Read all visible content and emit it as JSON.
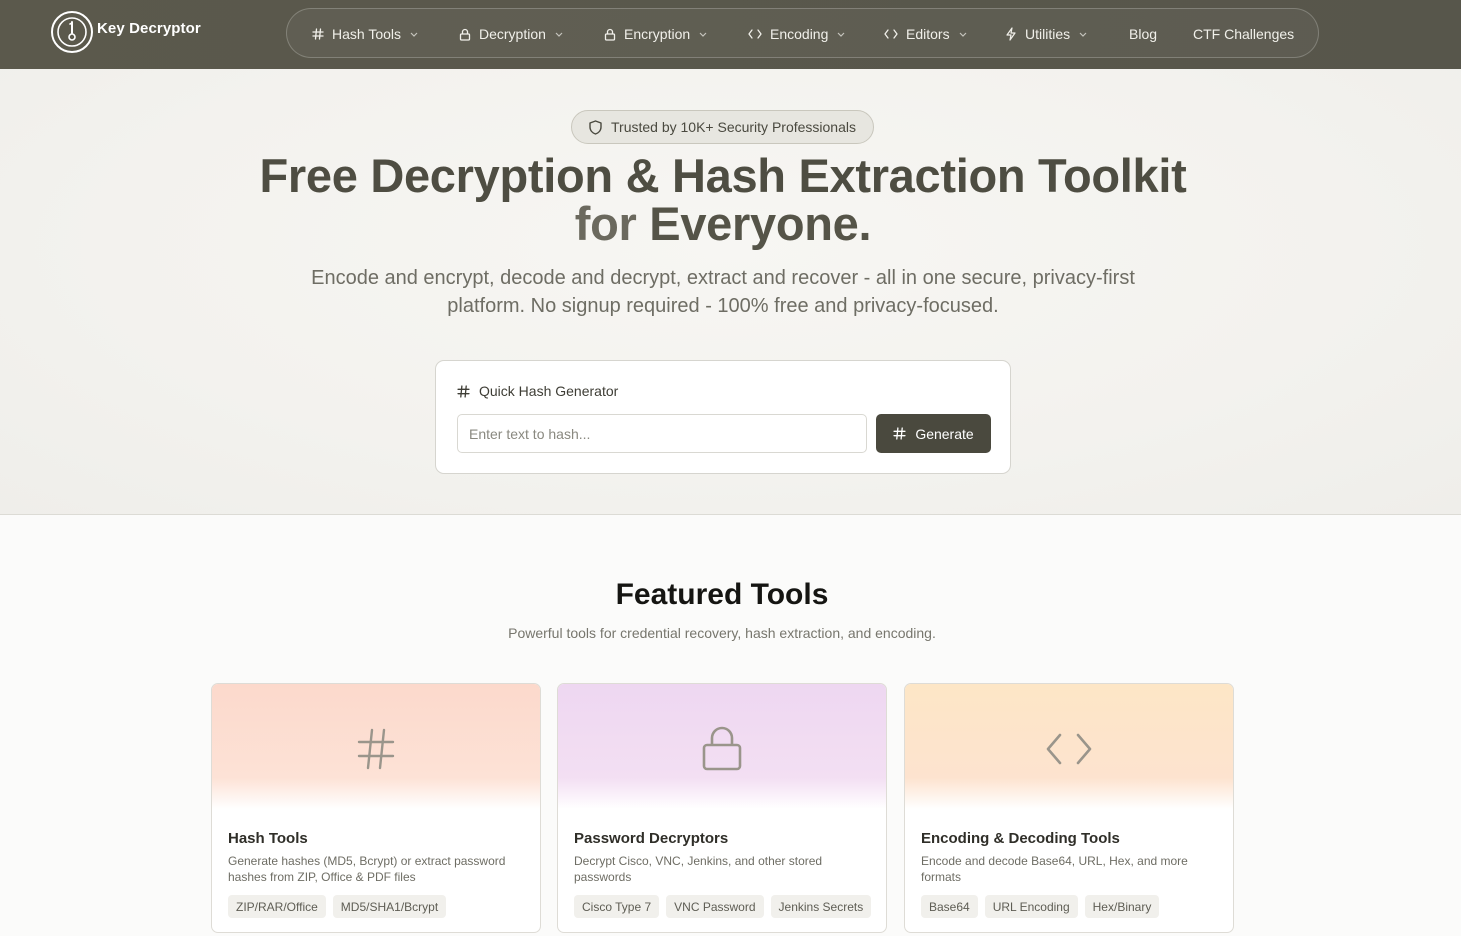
{
  "brand": {
    "name": "Key Decryptor"
  },
  "nav": {
    "items": [
      {
        "label": "Hash Tools",
        "icon": "hash-icon",
        "dropdown": true
      },
      {
        "label": "Decryption",
        "icon": "lock-icon",
        "dropdown": true
      },
      {
        "label": "Encryption",
        "icon": "lock-icon",
        "dropdown": true
      },
      {
        "label": "Encoding",
        "icon": "code-icon",
        "dropdown": true
      },
      {
        "label": "Editors",
        "icon": "code-icon",
        "dropdown": true
      },
      {
        "label": "Utilities",
        "icon": "bolt-icon",
        "dropdown": true
      },
      {
        "label": "Blog",
        "dropdown": false
      },
      {
        "label": "CTF Challenges",
        "dropdown": false
      }
    ]
  },
  "hero": {
    "badge": "Trusted by 10K+ Security Professionals",
    "title_line1": "Free Decryption & Hash Extraction Toolkit",
    "title_line2_a": "for ",
    "title_line2_b": "Everyone.",
    "subtitle": "Encode and encrypt, decode and decrypt, extract and recover - all in one secure, privacy-first platform. No signup required - 100% free and privacy-focused."
  },
  "quick_hash": {
    "title": "Quick Hash Generator",
    "placeholder": "Enter text to hash...",
    "value": "",
    "button_label": "Generate"
  },
  "featured": {
    "title": "Featured Tools",
    "subtitle": "Powerful tools for credential recovery, hash extraction, and encoding.",
    "cards": [
      {
        "title": "Hash Tools",
        "icon": "hash-icon",
        "description": "Generate hashes (MD5, Bcrypt) or extract password hashes from ZIP, Office & PDF files",
        "tags": [
          "ZIP/RAR/Office",
          "MD5/SHA1/Bcrypt"
        ],
        "tint": "#fcdcd0"
      },
      {
        "title": "Password Decryptors",
        "icon": "lock-icon",
        "description": "Decrypt Cisco, VNC, Jenkins, and other stored passwords",
        "tags": [
          "Cisco Type 7",
          "VNC Password",
          "Jenkins Secrets"
        ],
        "tint": "#efd8f2"
      },
      {
        "title": "Encoding & Decoding Tools",
        "icon": "code-icon",
        "description": "Encode and decode Base64, URL, Hex, and more formats",
        "tags": [
          "Base64",
          "URL Encoding",
          "Hex/Binary"
        ],
        "tint": "#fde4cc"
      }
    ]
  },
  "colors": {
    "header_bg": "#58574b",
    "primary_button": "#4a493e",
    "heading": "#4e4d42"
  }
}
